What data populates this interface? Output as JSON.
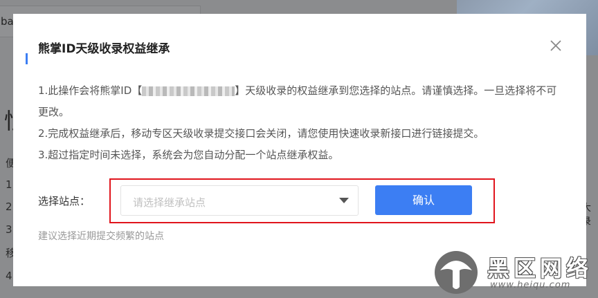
{
  "background": {
    "search_text": "baid",
    "big_char": "恨",
    "left_lines": [
      "便",
      "1",
      "2",
      "3",
      "移",
      "4"
    ],
    "right_text": "大录"
  },
  "dialog": {
    "title": "熊掌ID天级收录权益继承",
    "notes": [
      {
        "before": "1.此操作会将熊掌ID【",
        "after": "】天级收录的权益继承到您选择的站点。请谨慎选择。一旦选择将不可更改。"
      },
      {
        "text": "2.完成权益继承后，移动专区天级收录提交接口会关闭，请您使用快速收录新接口进行链接提交。"
      },
      {
        "text": "3.超过指定时间未选择，系统会为您自动分配一个站点继承权益。"
      }
    ],
    "site_label": "选择站点：",
    "select_placeholder": "请选择继承站点",
    "confirm_label": "确认",
    "hint": "建议选择近期提交频繁的站点"
  },
  "watermark": {
    "title": "黑区网络",
    "url": "www.heiqu.com"
  },
  "colors": {
    "primary": "#3c7ef3",
    "highlight": "#e0141c"
  }
}
